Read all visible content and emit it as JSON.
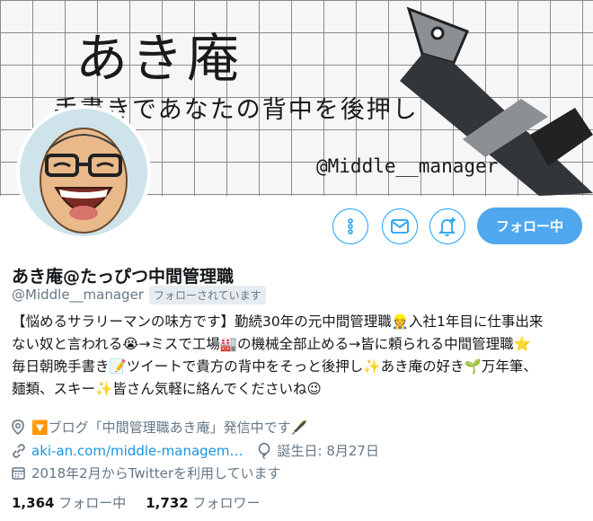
{
  "banner": {
    "title": "あき庵",
    "subtitle": "手書きであなたの背中を後押し",
    "handle": "@Middle__manager"
  },
  "profile": {
    "display_name": "あき庵@たっぴつ中間管理職",
    "handle": "@Middle__manager",
    "follows_you_badge": "フォローされています",
    "bio": "【悩めるサラリーマンの味方です】勤続30年の元中間管理職👷入社1年目に仕事出来\nない奴と言われる😭→ミスで工場🏭の機械全部止める→皆に頼られる中間管理職⭐\n毎日朝晩手書き📝ツイートで貴方の背中をそっと後押し✨あき庵の好き🌱万年筆、\n麺類、スキー✨皆さん気軽に絡んでくださいね😉",
    "location": "🔽ブログ「中間管理職あき庵」発信中です🖋️",
    "website": "aki-an.com/middle-managem…",
    "birthday": "誕生日: 8月27日",
    "joined": "2018年2月からTwitterを利用しています"
  },
  "actions": {
    "more_icon": "more-vertical-icon",
    "message_icon": "envelope-icon",
    "notify_icon": "bell-plus-icon",
    "follow_label": "フォロー中"
  },
  "stats": {
    "following_count": "1,364",
    "following_label": "フォロー中",
    "followers_count": "1,732",
    "followers_label": "フォロワー"
  },
  "colors": {
    "accent": "#1da1f2",
    "follow_button": "#4fa8ee",
    "link": "#1b95e0",
    "secondary_text": "#657786"
  }
}
